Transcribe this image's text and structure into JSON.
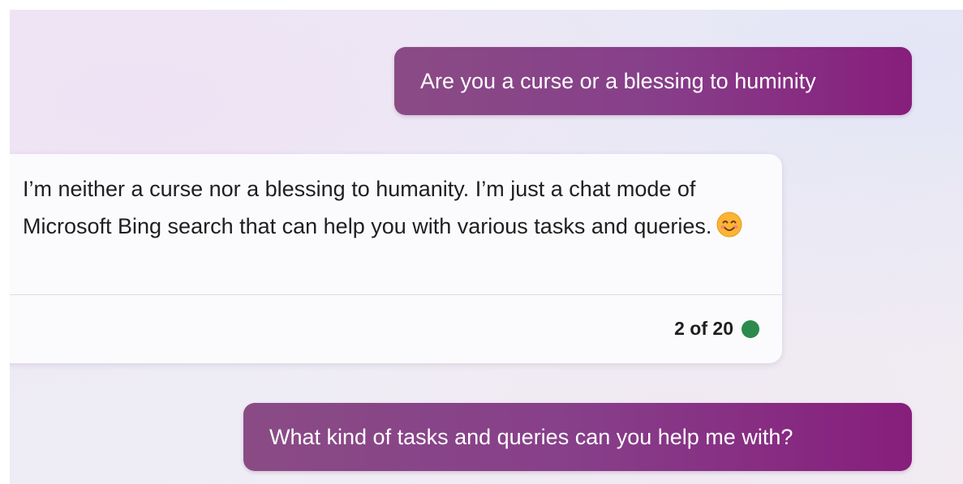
{
  "conversation": {
    "messages": [
      {
        "role": "user",
        "text": "Are you a curse or a blessing to huminity"
      },
      {
        "role": "assistant",
        "text": "I’m neither a curse nor a blessing to humanity. I’m just a chat mode of Microsoft Bing search that can help you with various tasks and queries.",
        "emoji": "smiling-face-with-smiling-eyes-icon",
        "turn_counter": "2 of 20",
        "status_color": "#2c8a4c"
      },
      {
        "role": "user",
        "text": "What kind of tasks and queries can you help me with?"
      }
    ]
  },
  "colors": {
    "user_bubble_start": "#8a4b85",
    "user_bubble_end": "#871e7c",
    "assistant_bubble": "#fbfbfd",
    "status_dot": "#2c8a4c"
  }
}
